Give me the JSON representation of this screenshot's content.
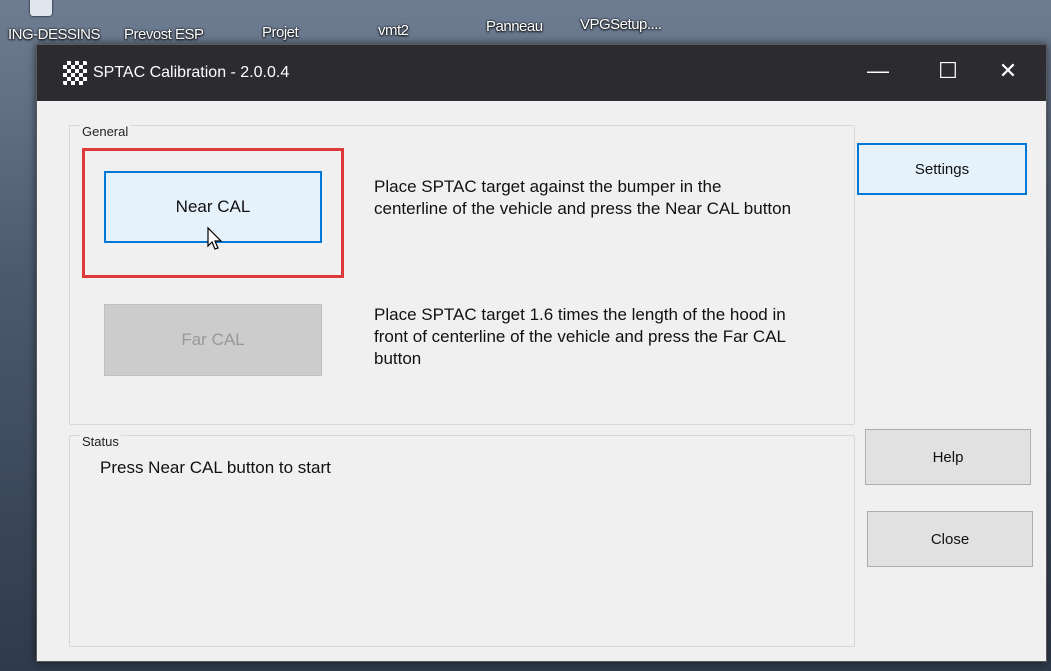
{
  "desktop": {
    "icons": [
      "ING-DESSINS",
      "Prevost ESP",
      "Projet",
      "vmt2",
      "Panneau",
      "VPGSetup...."
    ]
  },
  "window": {
    "title": "SPTAC Calibration - 2.0.0.4",
    "controls": {
      "minimize": "—",
      "maximize": "☐",
      "close": "✕"
    }
  },
  "general": {
    "group_label": "General",
    "near_cal_label": "Near CAL",
    "near_cal_instruction": "Place SPTAC target against the bumper in the centerline of the vehicle and press the Near CAL button",
    "far_cal_label": "Far CAL",
    "far_cal_instruction": "Place SPTAC target 1.6 times the length of the hood in front of centerline of the vehicle and press the Far CAL button"
  },
  "status": {
    "group_label": "Status",
    "message": "Press Near CAL button to start"
  },
  "side_buttons": {
    "settings": "Settings",
    "help": "Help",
    "close": "Close"
  },
  "colors": {
    "highlight": "#e0393a",
    "focus_border": "#0078d7"
  }
}
